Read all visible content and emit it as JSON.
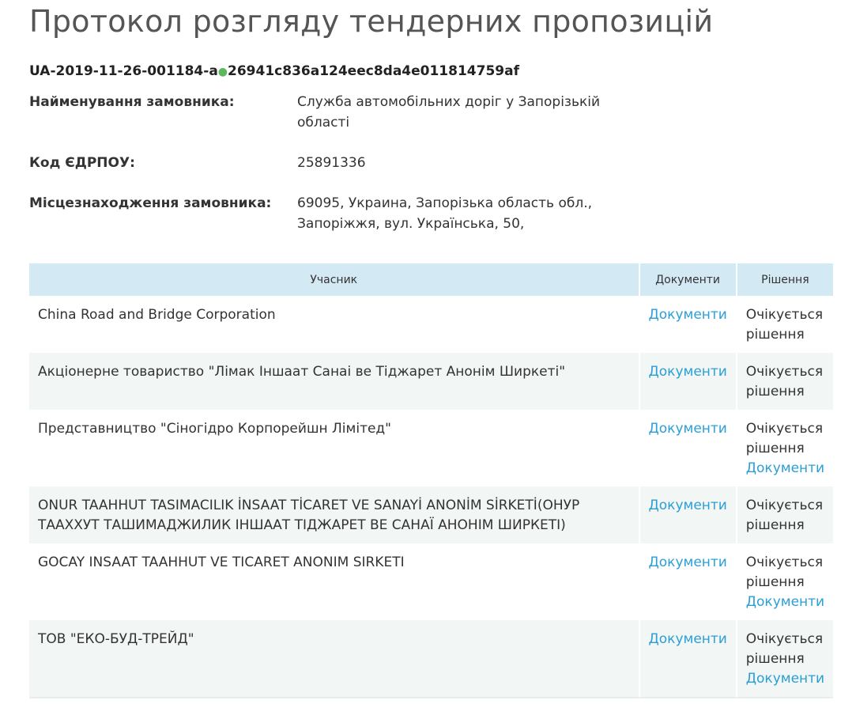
{
  "page_title": "Протокол розгляду тендерних пропозицій",
  "tender": {
    "id": "UA-2019-11-26-001184-a",
    "separator": "●",
    "hash": "26941c836a124eec8da4e011814759af"
  },
  "info": {
    "customer_label": "Найменування замовника:",
    "customer_value": "Служба автомобільних доріг у Запорізькій області",
    "edrpou_label": "Код ЄДРПОУ:",
    "edrpou_value": "25891336",
    "location_label": "Місцезнаходження замовника:",
    "location_value": "69095, Украина, Запорізька область обл., Запоріжжя, вул. Українська, 50,"
  },
  "table": {
    "headers": [
      "Учасник",
      "Документи",
      "Рішення"
    ],
    "rows": [
      {
        "name": "China Road and Bridge Corporation",
        "docs": "Документи",
        "decision": "Очікується рішення",
        "decision_docs": ""
      },
      {
        "name": "Акціонерне товариство \"Лімак Іншаат Санаі ве Тіджарет Анонім Ширкеті\"",
        "docs": "Документи",
        "decision": "Очікується рішення",
        "decision_docs": ""
      },
      {
        "name": "Представництво \"Сіногідро Корпорейшн Лімітед\"",
        "docs": "Документи",
        "decision": "Очікується рішення",
        "decision_docs": "Документи"
      },
      {
        "name": "ONUR TAAHHUT TASIMACILIK İNSAAT TİCARET VE SANAYİ ANONİM SİRKETİ(ОНУР ТААХХУТ ТАШИМАДЖИЛИК ІНШААТ ТІДЖАРЕТ ВЕ САНАЇ АНОНІМ ШИРКЕТІ)",
        "docs": "Документи",
        "decision": "Очікується рішення",
        "decision_docs": ""
      },
      {
        "name": "GOCAY INSAAT TAAHHUT VE TICARET ANONIM SIRKETI",
        "docs": "Документи",
        "decision": "Очікується рішення",
        "decision_docs": "Документи"
      },
      {
        "name": "ТОВ \"ЕКО-БУД-ТРЕЙД\"",
        "docs": "Документи",
        "decision": "Очікується рішення",
        "decision_docs": "Документи"
      }
    ]
  },
  "colors": {
    "header_bg": "#d3e9f3",
    "alt_row_bg": "#f2f6f5",
    "link": "#2a9fd6",
    "status_dot": "#5cb85c"
  }
}
